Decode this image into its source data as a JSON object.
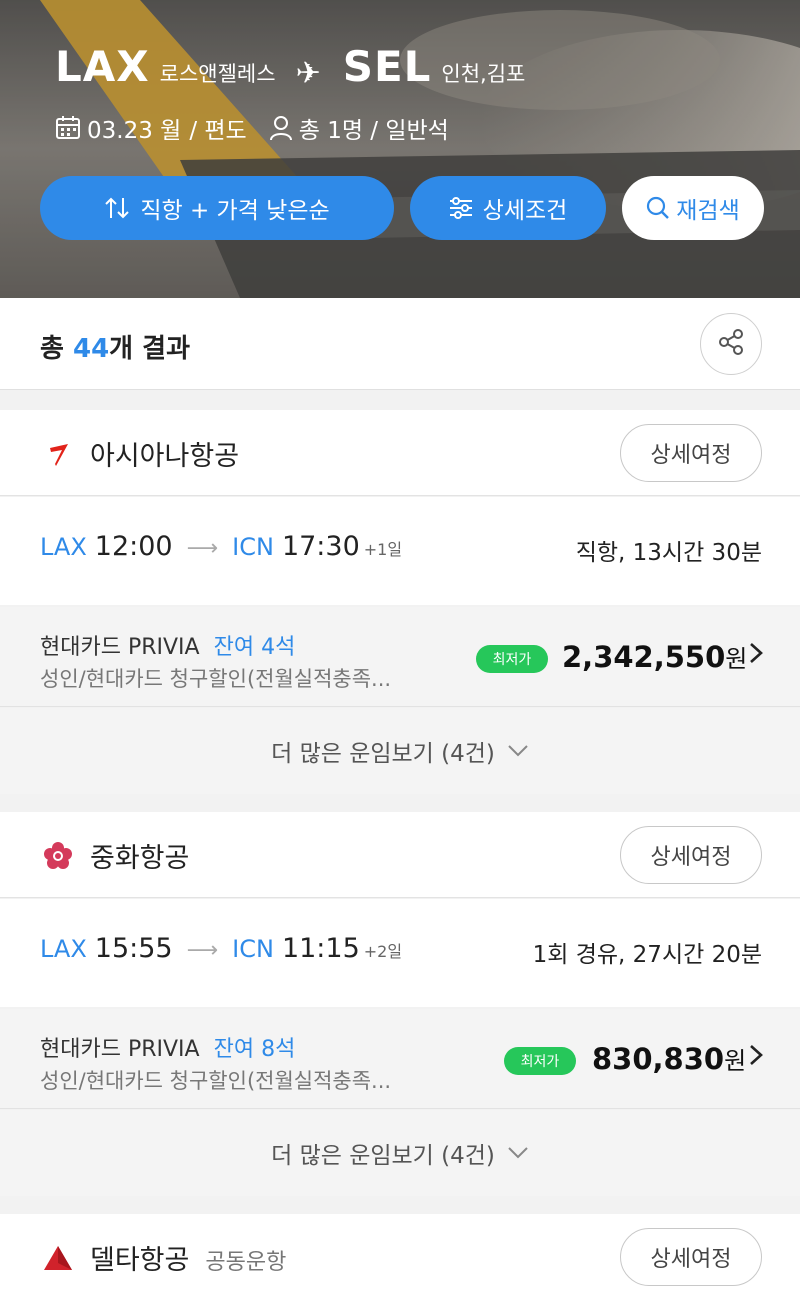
{
  "header": {
    "origin_code": "LAX",
    "origin_city": "로스앤젤레스",
    "dest_code": "SEL",
    "dest_city": "인천,김포",
    "date": "03.23 월",
    "trip_type": "/ 편도",
    "passengers": "총 1명 / 일반석",
    "sort_button": "직항 + 가격 낮은순",
    "filter_button": "상세조건",
    "research_button": "재검색",
    "colors": {
      "accent": "#2f8ae8",
      "badge_green": "#26c75a"
    }
  },
  "results": {
    "prefix": "총",
    "count": "44",
    "suffix": "개 결과"
  },
  "airlines": [
    {
      "name": "아시아나항공",
      "sub": "",
      "detail_button": "상세여정",
      "dep_airport": "LAX",
      "dep_time": "12:00",
      "arr_airport": "ICN",
      "arr_time": "17:30",
      "day_plus": "+1일",
      "duration": "직항, 13시간 30분",
      "card_name": "현대카드 PRIVIA",
      "seats": "잔여 4석",
      "condition": "성인/현대카드 청구할인(전월실적충족...",
      "badge": "최저가",
      "price": "2,342,550",
      "currency": "원",
      "more": "더 많은 운임보기 (4건)"
    },
    {
      "name": "중화항공",
      "sub": "",
      "detail_button": "상세여정",
      "dep_airport": "LAX",
      "dep_time": "15:55",
      "arr_airport": "ICN",
      "arr_time": "11:15",
      "day_plus": "+2일",
      "duration": "1회 경유, 27시간 20분",
      "card_name": "현대카드 PRIVIA",
      "seats": "잔여 8석",
      "condition": "성인/현대카드 청구할인(전월실적충족...",
      "badge": "최저가",
      "price": "830,830",
      "currency": "원",
      "more": "더 많은 운임보기 (4건)"
    },
    {
      "name": "델타항공",
      "sub": "공동운항",
      "detail_button": "상세여정"
    }
  ],
  "icons": [
    "calendar-icon",
    "person-icon",
    "plane-icon",
    "sort-icon",
    "filter-icon",
    "search-icon",
    "share-icon",
    "chevron-right-icon",
    "chevron-down-icon"
  ]
}
